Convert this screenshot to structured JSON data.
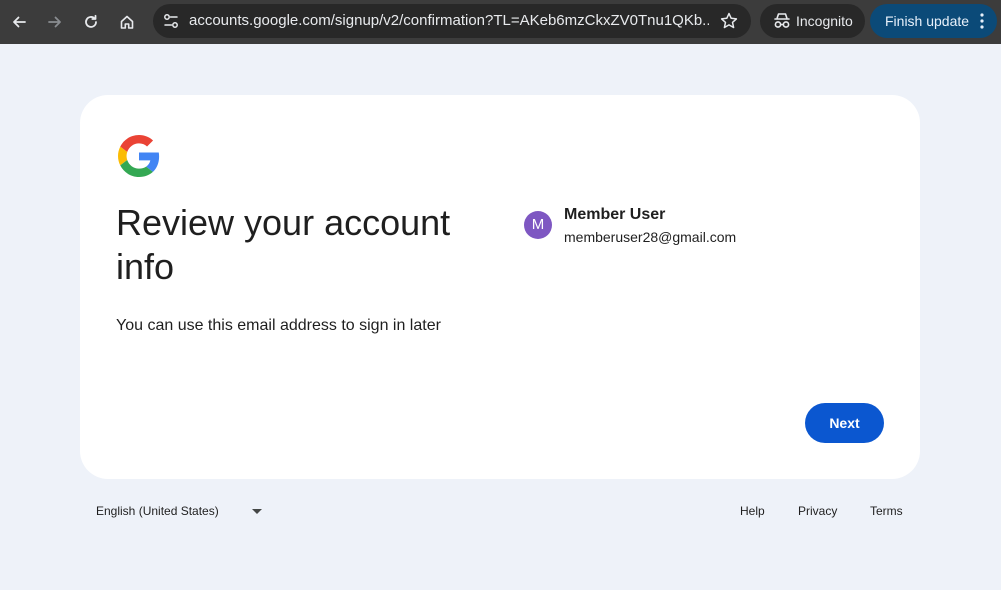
{
  "browser": {
    "url": "accounts.google.com/signup/v2/confirmation?TL=AKeb6mzCkxZV0Tnu1QKb...",
    "incognito_label": "Incognito",
    "finish_update_label": "Finish update"
  },
  "card": {
    "title": "Review your account info",
    "subtitle": "You can use this email address to sign in later",
    "account": {
      "avatar_letter": "M",
      "name": "Member User",
      "email": "memberuser28@gmail.com",
      "avatar_color": "#7e57c2"
    },
    "next_label": "Next"
  },
  "footer": {
    "language": "English (United States)",
    "links": [
      "Help",
      "Privacy",
      "Terms"
    ]
  },
  "colors": {
    "accent": "#0b57d0",
    "page_bg": "#eef2f9"
  }
}
